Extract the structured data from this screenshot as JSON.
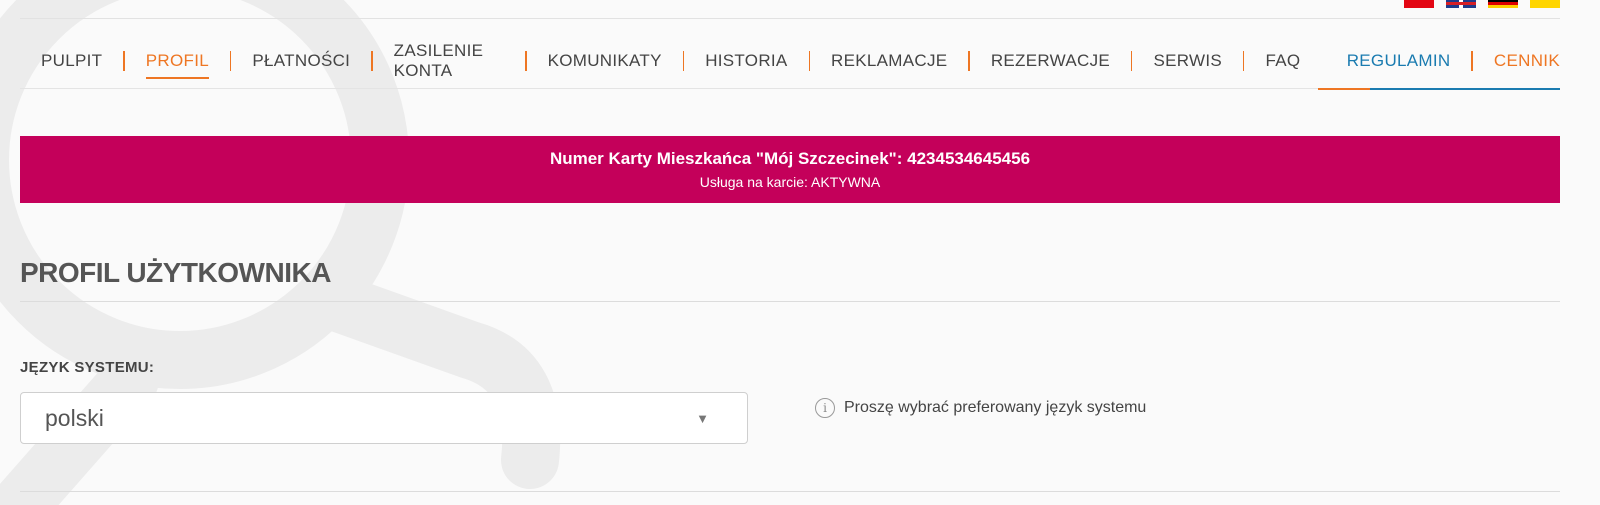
{
  "flags": [
    {
      "name": "flag-pl-icon",
      "color": "#e30613"
    },
    {
      "name": "flag-gb-icon",
      "color": "#1f3a8a"
    },
    {
      "name": "flag-de-icon",
      "color": "#ffce00"
    },
    {
      "name": "flag-ua-icon",
      "color": "#ffd500"
    }
  ],
  "nav": {
    "items": [
      {
        "label": "PULPIT"
      },
      {
        "label": "PROFIL"
      },
      {
        "label": "PŁATNOŚCI"
      },
      {
        "label": "ZASILENIE KONTA"
      },
      {
        "label": "KOMUNIKATY"
      },
      {
        "label": "HISTORIA"
      },
      {
        "label": "REKLAMACJE"
      },
      {
        "label": "REZERWACJE"
      },
      {
        "label": "SERWIS"
      },
      {
        "label": "FAQ"
      }
    ],
    "active": "PROFIL",
    "regulamin": "REGULAMIN",
    "cennik": "CENNIK"
  },
  "banner": {
    "title": "Numer Karty Mieszkańca \"Mój Szczecinek\": 4234534645456",
    "subtitle": "Usługa na karcie: AKTYWNA",
    "color": "#c4005a"
  },
  "page": {
    "title": "PROFIL UŻYTKOWNIKA"
  },
  "language": {
    "label": "JĘZYK SYSTEMU:",
    "value": "polski",
    "hint": "Proszę wybrać preferowany język systemu"
  },
  "colors": {
    "accent_orange": "#ee7623",
    "accent_blue": "#1a7bb0"
  }
}
